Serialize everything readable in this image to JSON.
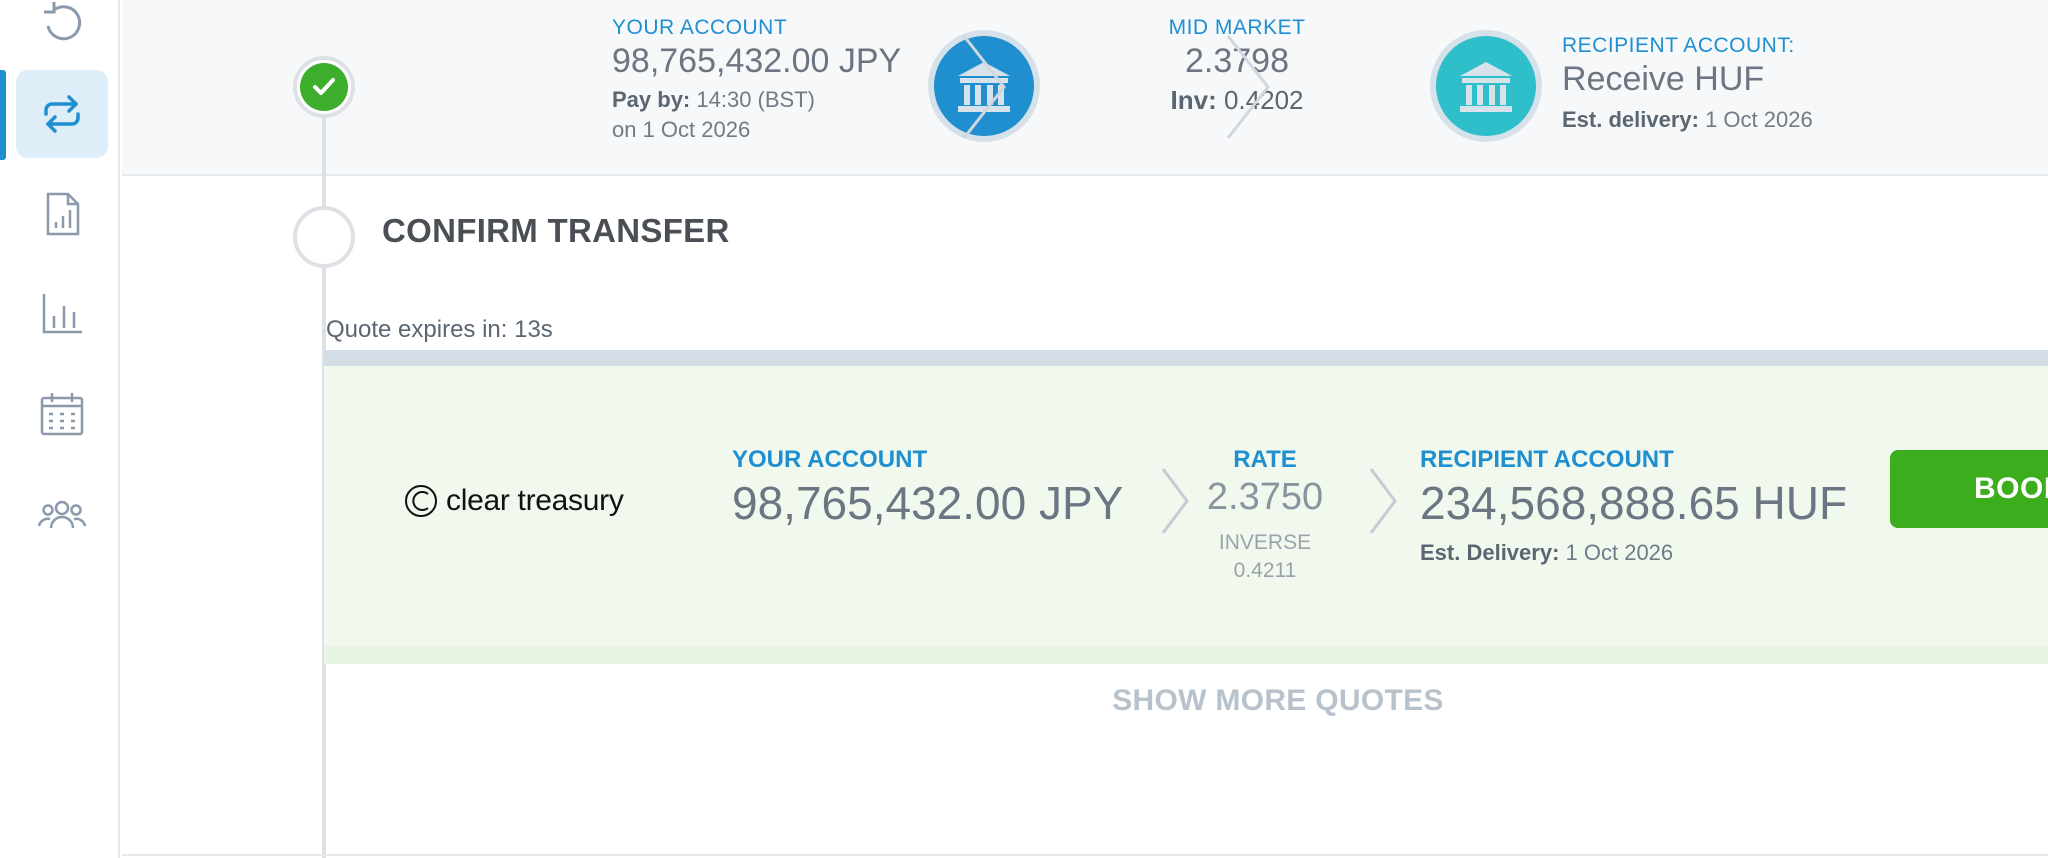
{
  "sidebar": {
    "items": [
      {
        "icon": "history-icon",
        "active": false
      },
      {
        "icon": "transfer-icon",
        "active": true
      },
      {
        "icon": "report-icon",
        "active": false
      },
      {
        "icon": "bar-chart-icon",
        "active": false
      },
      {
        "icon": "calendar-icon",
        "active": false
      },
      {
        "icon": "users-icon",
        "active": false
      }
    ]
  },
  "summary": {
    "your_account_label": "YOUR ACCOUNT",
    "your_account_amount": "98,765,432.00 JPY",
    "pay_by_label": "Pay by:",
    "pay_by_time": "14:30 (BST)",
    "pay_by_date": "on 1 Oct 2026",
    "mid_market_label": "MID MARKET",
    "mid_market_rate": "2.3798",
    "inv_label": "Inv:",
    "inv_value": "0.4202",
    "recipient_label": "RECIPIENT ACCOUNT:",
    "recipient_value": "Receive HUF",
    "est_delivery_label": "Est. delivery:",
    "est_delivery_date": "1 Oct 2026"
  },
  "confirm": {
    "title": "CONFIRM TRANSFER",
    "quote_expires": "Quote expires in: 13s"
  },
  "quote": {
    "provider": "clear treasury",
    "your_account_label": "YOUR ACCOUNT",
    "your_account_amount": "98,765,432.00 JPY",
    "rate_label": "RATE",
    "rate_value": "2.3750",
    "inverse_label": "INVERSE",
    "inverse_value": "0.4211",
    "recipient_label": "RECIPIENT ACCOUNT",
    "recipient_amount": "234,568,888.65 HUF",
    "est_delivery_label": "Est. Delivery:",
    "est_delivery_date": "1 Oct 2026",
    "book_label": "BOOK"
  },
  "show_more_label": "SHOW MORE QUOTES",
  "colors": {
    "accent": "#1f8fd0",
    "success": "#3cae2c",
    "quote_bg": "#f1f9ef"
  }
}
